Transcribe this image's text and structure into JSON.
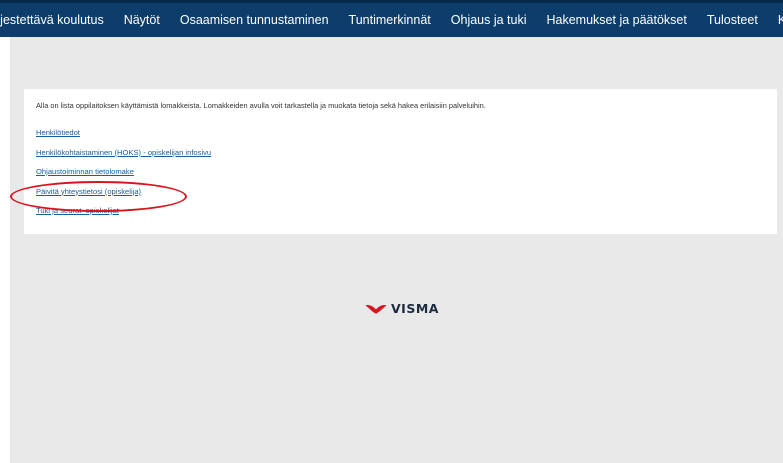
{
  "navbar": {
    "items": [
      "rjestettävä koulutus",
      "Näytöt",
      "Osaamisen tunnustaminen",
      "Tuntimerkinnät",
      "Ohjaus ja tuki",
      "Hakemukset ja päätökset",
      "Tulosteet",
      "Kys"
    ]
  },
  "main": {
    "intro": "Alla on lista oppilaitoksen käyttämistä lomakkeista. Lomakkeiden avulla voit tarkastella ja muokata tietoja sekä hakea erilaisiin palveluihin.",
    "links": [
      "Henkilötiedot",
      "Henkilökohtaistaminen (HOKS) - opiskelijan infosivu",
      "Ohjaustoiminnan tietolomake",
      "Päivitä yhteystietosi (opiskelija)",
      "Tuki ja seurat_opiskelijat"
    ]
  },
  "logo": {
    "text": "VISMA",
    "color": "#d8151e"
  },
  "annotation": {
    "color": "#d8151e"
  }
}
